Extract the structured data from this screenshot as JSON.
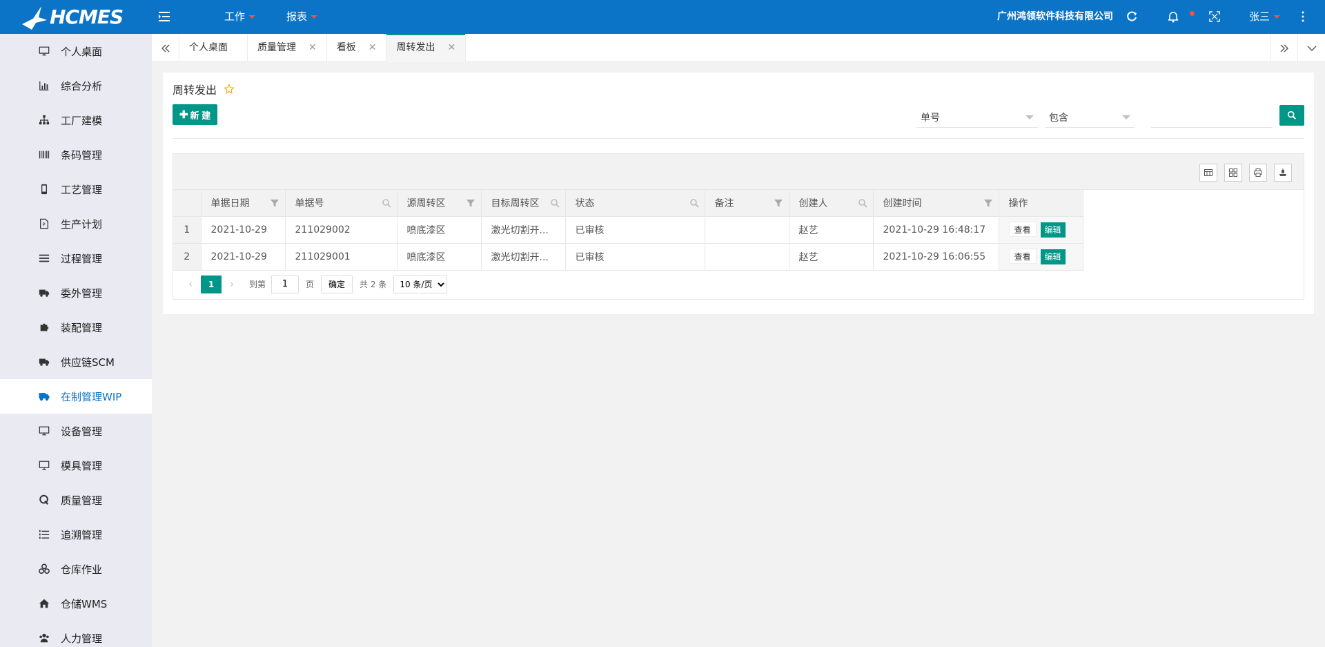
{
  "app": {
    "logo_text": "HCMES",
    "company": "广州鸿领软件科技有限公司",
    "user": "张三"
  },
  "top_menu": [
    {
      "label": "工作"
    },
    {
      "label": "报表"
    }
  ],
  "sidebar": {
    "items": [
      {
        "label": "个人桌面",
        "icon": "monitor-icon"
      },
      {
        "label": "综合分析",
        "icon": "bar-chart-icon"
      },
      {
        "label": "工厂建模",
        "icon": "sitemap-icon"
      },
      {
        "label": "条码管理",
        "icon": "barcode-icon"
      },
      {
        "label": "工艺管理",
        "icon": "mobile-icon"
      },
      {
        "label": "生产计划",
        "icon": "file-icon"
      },
      {
        "label": "过程管理",
        "icon": "list-icon"
      },
      {
        "label": "委外管理",
        "icon": "truck-icon"
      },
      {
        "label": "装配管理",
        "icon": "puzzle-icon"
      },
      {
        "label": "供应链SCM",
        "icon": "truck-icon"
      },
      {
        "label": "在制管理WIP",
        "icon": "truck-icon",
        "active": true
      },
      {
        "label": "设备管理",
        "icon": "monitor-icon"
      },
      {
        "label": "模具管理",
        "icon": "monitor-icon"
      },
      {
        "label": "质量管理",
        "icon": "q-icon"
      },
      {
        "label": "追溯管理",
        "icon": "list-ol-icon"
      },
      {
        "label": "仓库作业",
        "icon": "cubes-icon"
      },
      {
        "label": "仓储WMS",
        "icon": "home-icon"
      },
      {
        "label": "人力管理",
        "icon": "users-icon"
      }
    ]
  },
  "tabs": [
    {
      "label": "个人桌面",
      "closable": false
    },
    {
      "label": "质量管理",
      "closable": true
    },
    {
      "label": "看板",
      "closable": true
    },
    {
      "label": "周转发出",
      "closable": true,
      "active": true
    }
  ],
  "page": {
    "title": "周转发出",
    "new_label": "新 建",
    "filter_field": "单号",
    "filter_op": "包含",
    "search_value": ""
  },
  "table": {
    "columns": [
      "单据日期",
      "单据号",
      "源周转区",
      "目标周转区",
      "状态",
      "备注",
      "创建人",
      "创建时间",
      "操作"
    ],
    "rows": [
      {
        "no": "1",
        "date": "2021-10-29",
        "doc": "211029002",
        "src": "喷底漆区",
        "dst": "激光切割开...",
        "status": "已审核",
        "remark": "",
        "creator": "赵艺",
        "created": "2021-10-29 16:48:17"
      },
      {
        "no": "2",
        "date": "2021-10-29",
        "doc": "211029001",
        "src": "喷底漆区",
        "dst": "激光切割开...",
        "status": "已审核",
        "remark": "",
        "creator": "赵艺",
        "created": "2021-10-29 16:06:55"
      }
    ],
    "view_label": "查看",
    "edit_label": "编辑"
  },
  "pager": {
    "current": "1",
    "goto_label": "到第",
    "goto_value": "1",
    "page_suffix": "页",
    "ok_label": "确定",
    "total": "共 2 条",
    "page_size": "10 条/页"
  }
}
